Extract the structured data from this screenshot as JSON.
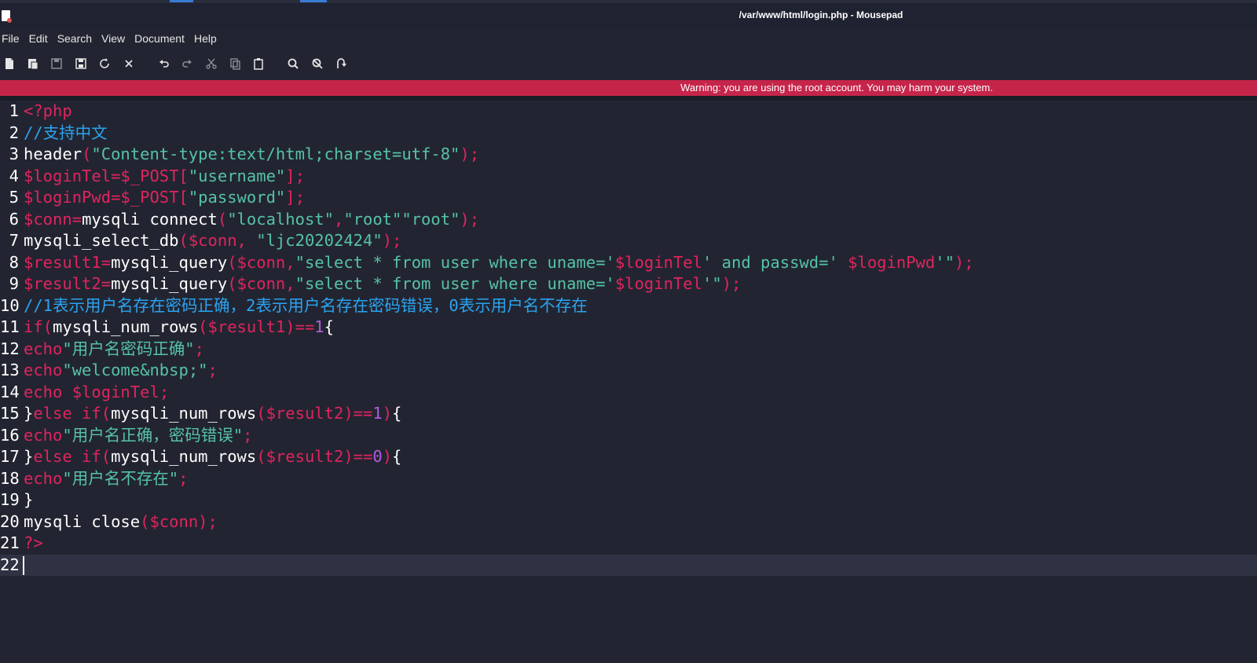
{
  "window": {
    "title": "/var/www/html/login.php - Mousepad"
  },
  "menu": [
    "File",
    "Edit",
    "Search",
    "View",
    "Document",
    "Help"
  ],
  "toolbar": [
    {
      "name": "new-document-icon",
      "glyph": "new"
    },
    {
      "name": "new-window-icon",
      "glyph": "newwin"
    },
    {
      "name": "save-icon",
      "glyph": "save"
    },
    {
      "name": "save-as-icon",
      "glyph": "saveas"
    },
    {
      "name": "reload-icon",
      "glyph": "reload"
    },
    {
      "name": "close-icon",
      "glyph": "close"
    },
    {
      "name": "undo-icon",
      "glyph": "undo"
    },
    {
      "name": "redo-icon",
      "glyph": "redo"
    },
    {
      "name": "cut-icon",
      "glyph": "cut"
    },
    {
      "name": "copy-icon",
      "glyph": "copy"
    },
    {
      "name": "paste-icon",
      "glyph": "paste"
    },
    {
      "name": "find-icon",
      "glyph": "find"
    },
    {
      "name": "find-replace-icon",
      "glyph": "replace"
    },
    {
      "name": "go-to-line-icon",
      "glyph": "goto"
    }
  ],
  "warning": "Warning: you are using the root account. You may harm your system.",
  "editor": {
    "current_line": 22,
    "lines": [
      [
        [
          "kw",
          "<?php"
        ]
      ],
      [
        [
          "cm",
          "//支持中文"
        ]
      ],
      [
        [
          "fn",
          "header"
        ],
        [
          "kw",
          "("
        ],
        [
          "str",
          "\"Content-type:text/html;charset=utf-8\""
        ],
        [
          "kw",
          ");"
        ]
      ],
      [
        [
          "var",
          "$loginTel=$_POST["
        ],
        [
          "str",
          "\"username\""
        ],
        [
          "var",
          "];"
        ]
      ],
      [
        [
          "var",
          "$loginPwd=$_POST["
        ],
        [
          "str",
          "\"password\""
        ],
        [
          "var",
          "];"
        ]
      ],
      [
        [
          "var",
          "$conn="
        ],
        [
          "fn",
          "mysqli connect"
        ],
        [
          "kw",
          "("
        ],
        [
          "str",
          "\"localhost\""
        ],
        [
          "kw",
          ","
        ],
        [
          "str",
          "\"root\"\"root\""
        ],
        [
          "kw",
          ");"
        ]
      ],
      [
        [
          "fn",
          "mysqli_select_db"
        ],
        [
          "kw",
          "("
        ],
        [
          "var",
          "$conn"
        ],
        [
          "kw",
          ", "
        ],
        [
          "str",
          "\"ljc20202424\""
        ],
        [
          "kw",
          ");"
        ]
      ],
      [
        [
          "var",
          "$result1="
        ],
        [
          "fn",
          "mysqli_query"
        ],
        [
          "kw",
          "("
        ],
        [
          "var",
          "$conn"
        ],
        [
          "kw",
          ","
        ],
        [
          "str",
          "\"select * from user where uname='"
        ],
        [
          "var",
          "$loginTel"
        ],
        [
          "str",
          "' and passwd=' "
        ],
        [
          "var",
          "$loginPwd"
        ],
        [
          "str",
          "'\""
        ],
        [
          "kw",
          ");"
        ]
      ],
      [
        [
          "var",
          "$result2="
        ],
        [
          "fn",
          "mysqli_query"
        ],
        [
          "kw",
          "("
        ],
        [
          "var",
          "$conn"
        ],
        [
          "kw",
          ","
        ],
        [
          "str",
          "\"select * from user where uname='"
        ],
        [
          "var",
          "$loginTel"
        ],
        [
          "str",
          "'\""
        ],
        [
          "kw",
          ");"
        ]
      ],
      [
        [
          "cm",
          "//1表示用户名存在密码正确，2表示用户名存在密码错误，0表示用户名不存在"
        ]
      ],
      [
        [
          "kw",
          "if("
        ],
        [
          "fn",
          "mysqli_num_rows"
        ],
        [
          "kw",
          "("
        ],
        [
          "var",
          "$result1"
        ],
        [
          "kw",
          ")=="
        ],
        [
          "num",
          "1"
        ],
        [
          "pl",
          "{"
        ]
      ],
      [
        [
          "kw",
          "echo"
        ],
        [
          "str",
          "\"用户名密码正确\""
        ],
        [
          "kw",
          ";"
        ]
      ],
      [
        [
          "kw",
          "echo"
        ],
        [
          "str",
          "\"welcome&nbsp;\""
        ],
        [
          "kw",
          ";"
        ]
      ],
      [
        [
          "kw",
          "echo "
        ],
        [
          "var",
          "$loginTel"
        ],
        [
          "kw",
          ";"
        ]
      ],
      [
        [
          "pl",
          "}"
        ],
        [
          "kw",
          "else if("
        ],
        [
          "fn",
          "mysqli_num_rows"
        ],
        [
          "kw",
          "("
        ],
        [
          "var",
          "$result2"
        ],
        [
          "kw",
          ")=="
        ],
        [
          "num",
          "1"
        ],
        [
          "kw",
          ")"
        ],
        [
          "pl",
          "{"
        ]
      ],
      [
        [
          "kw",
          "echo"
        ],
        [
          "str",
          "\"用户名正确，密码错误\""
        ],
        [
          "kw",
          ";"
        ]
      ],
      [
        [
          "pl",
          "}"
        ],
        [
          "kw",
          "else if("
        ],
        [
          "fn",
          "mysqli_num_rows"
        ],
        [
          "kw",
          "("
        ],
        [
          "var",
          "$result2"
        ],
        [
          "kw",
          ")=="
        ],
        [
          "num",
          "0"
        ],
        [
          "kw",
          ")"
        ],
        [
          "pl",
          "{"
        ]
      ],
      [
        [
          "kw",
          "echo"
        ],
        [
          "str",
          "\"用户名不存在\""
        ],
        [
          "kw",
          ";"
        ]
      ],
      [
        [
          "pl",
          "}"
        ]
      ],
      [
        [
          "fn",
          "mysqli close"
        ],
        [
          "kw",
          "("
        ],
        [
          "var",
          "$conn"
        ],
        [
          "kw",
          ");"
        ]
      ],
      [
        [
          "kw",
          "?>"
        ]
      ],
      []
    ]
  }
}
